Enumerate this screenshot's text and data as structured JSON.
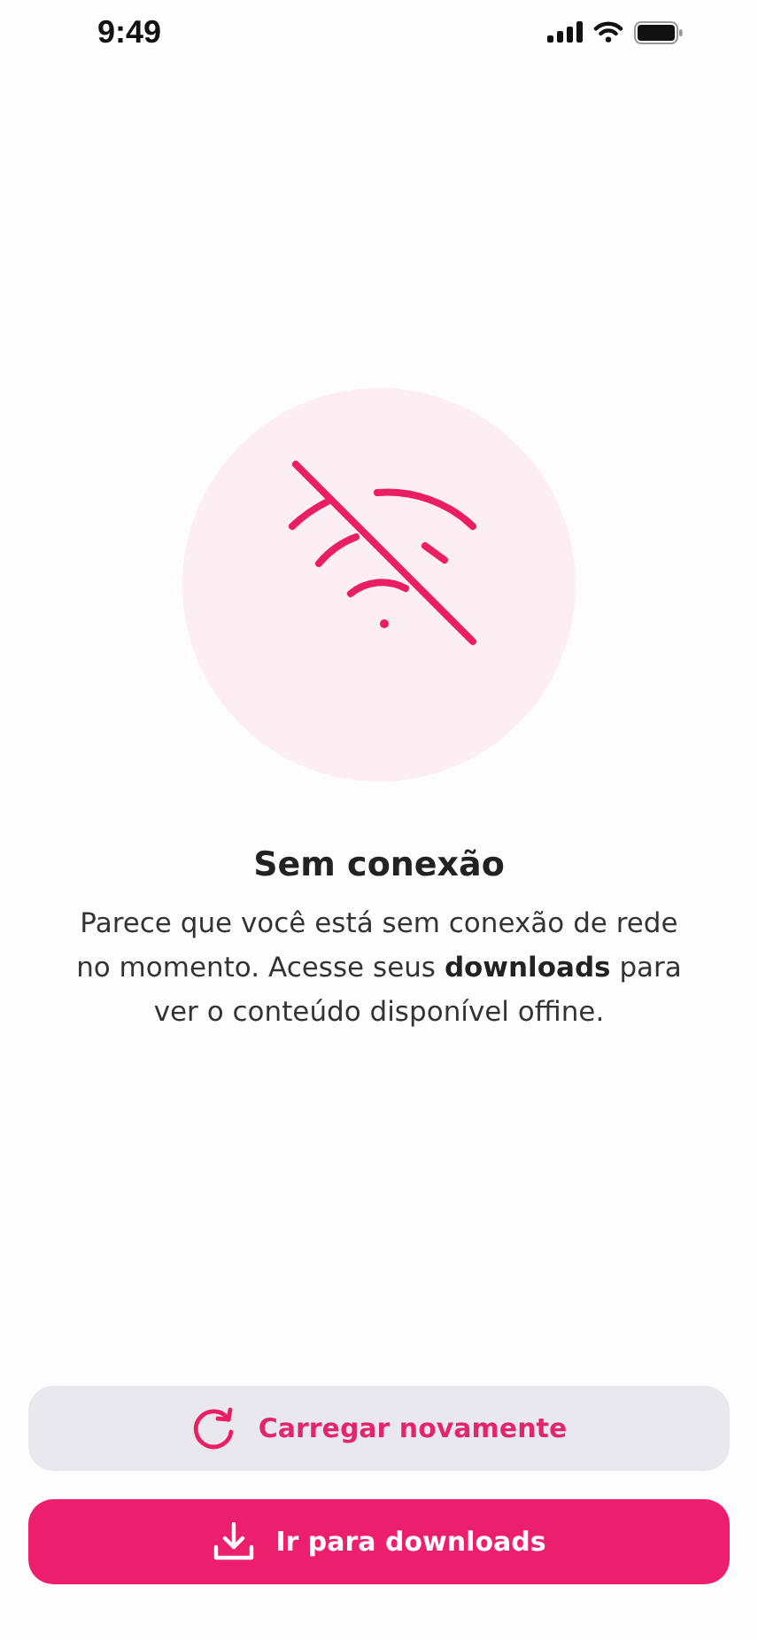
{
  "status_bar": {
    "time": "9:49"
  },
  "message": {
    "title": "Sem conexão",
    "body": "Parece que você está sem conexão de rede no momento. Acesse seus **downloads** para ver o conteúdo disponível offine."
  },
  "buttons": [
    {
      "kind": "secondary",
      "label": "Carregar novamente"
    },
    {
      "kind": "primary",
      "label": "Ir para downloads"
    }
  ]
}
